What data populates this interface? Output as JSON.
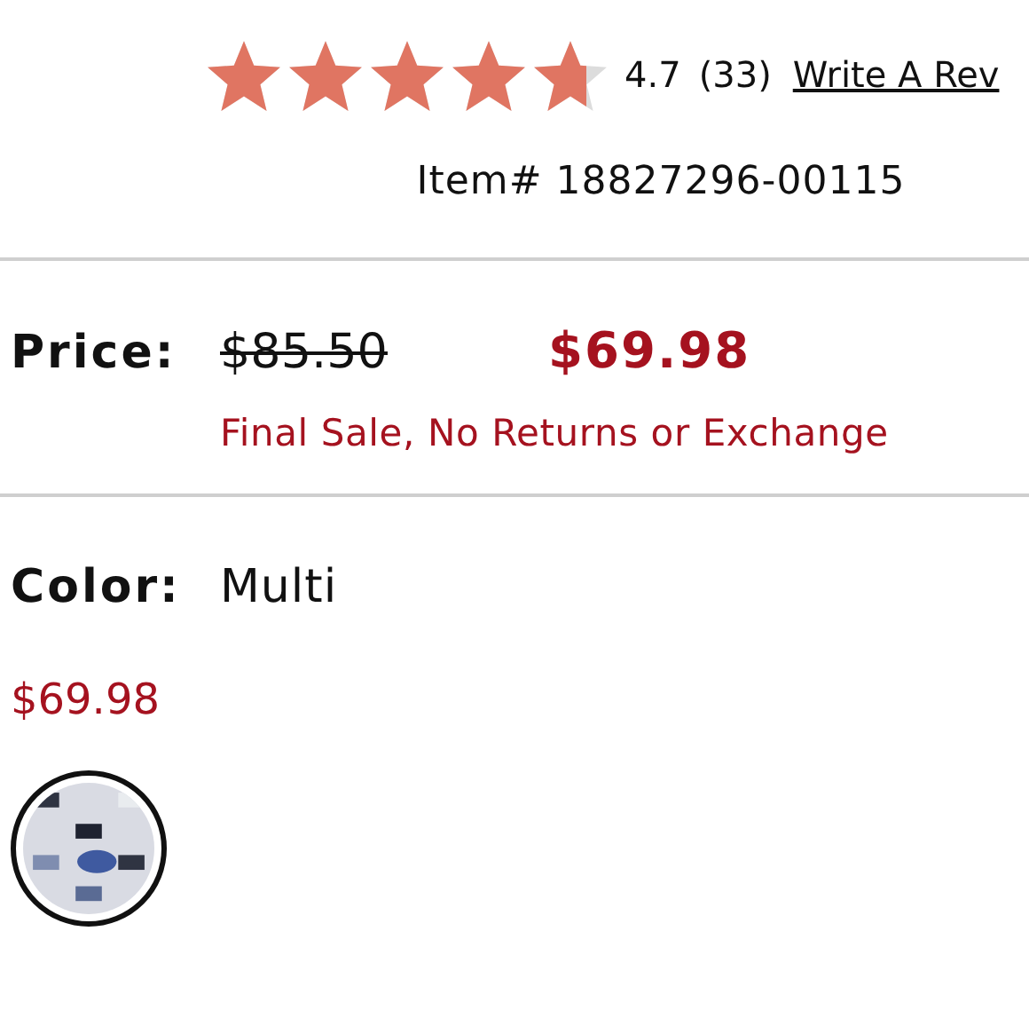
{
  "rating": {
    "stars": 4.7,
    "score": "4.7",
    "count": "(33)",
    "review_link": "Write A Rev"
  },
  "item_number": "Item# 18827296-00115",
  "price": {
    "label": "Price:",
    "original": "$85.50",
    "sale": "$69.98",
    "note": "Final Sale, No Returns or Exchange"
  },
  "color": {
    "label": "Color:",
    "value": "Multi"
  },
  "swatch_price": "$69.98",
  "swatches": [
    {
      "kind": "picture",
      "selected": true
    }
  ]
}
